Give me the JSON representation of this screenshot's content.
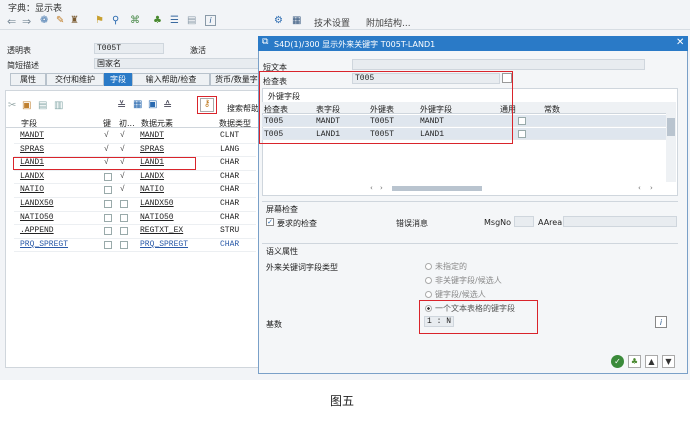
{
  "window_title": "字典：显示表",
  "menu": {
    "tech_settings": "技术设置",
    "append_struct": "附加结构..."
  },
  "left": {
    "transparent_table_label": "透明表",
    "transparent_table_value": "T005T",
    "active_label": "激活",
    "short_desc_label": "简短描述",
    "short_desc_value": "国家名",
    "tabs": [
      "属性",
      "交付和维护",
      "字段",
      "输入帮助/检查",
      "货币/数量字"
    ],
    "search_help_label": "搜索帮助",
    "columns": [
      "字段",
      "键",
      "初...",
      "数据元素",
      "数据类型"
    ],
    "rows": [
      {
        "field": "MANDT",
        "key": "√",
        "init": "√",
        "elem": "MANDT",
        "type": "CLNT"
      },
      {
        "field": "SPRAS",
        "key": "√",
        "init": "√",
        "elem": "SPRAS",
        "type": "LANG"
      },
      {
        "field": "LAND1",
        "key": "√",
        "init": "√",
        "elem": "LAND1",
        "type": "CHAR"
      },
      {
        "field": "LANDX",
        "key": "",
        "init": "√",
        "elem": "LANDX",
        "type": "CHAR"
      },
      {
        "field": "NATIO",
        "key": "",
        "init": "√",
        "elem": "NATIO",
        "type": "CHAR"
      },
      {
        "field": "LANDX50",
        "key": "",
        "init": "",
        "elem": "LANDX50",
        "type": "CHAR"
      },
      {
        "field": "NATIO50",
        "key": "",
        "init": "",
        "elem": "NATIO50",
        "type": "CHAR"
      },
      {
        "field": ".APPEND",
        "key": "",
        "init": "",
        "elem": "REGTXT_EX",
        "type": "STRU"
      },
      {
        "field": "PRQ_SPREGT",
        "key": "",
        "init": "",
        "elem": "PRQ_SPREGT",
        "type": "CHAR"
      }
    ]
  },
  "dialog": {
    "title": "S4D(1)/300 显示外来关键字 T005T-LAND1",
    "short_text_label": "短文本",
    "check_table_label": "检查表",
    "check_table_value": "T005",
    "fk_fields_label": "外键字段",
    "fk_columns": [
      "检查表",
      "表字段",
      "外键表",
      "外键字段",
      "通用",
      "常数"
    ],
    "fk_rows": [
      {
        "check": "T005",
        "table_field": "MANDT",
        "fk_table": "T005T",
        "fk_field": "MANDT"
      },
      {
        "check": "T005",
        "table_field": "LAND1",
        "fk_table": "T005T",
        "fk_field": "LAND1"
      }
    ],
    "screen_check_label": "屏幕检查",
    "required_check_label": "要求的检查",
    "error_msg_label": "错误消息",
    "msgno_label": "MsgNo",
    "aarea_label": "AArea",
    "semantic_label": "语义属性",
    "fk_field_type_label": "外来关键词字段类型",
    "radio_options": [
      "未指定的",
      "非关键字段/候选人",
      "键字段/候选人",
      "一个文本表格的键字段"
    ],
    "cardinality_label": "基数",
    "cardinality_value": "1 : N"
  },
  "caption": "图五"
}
